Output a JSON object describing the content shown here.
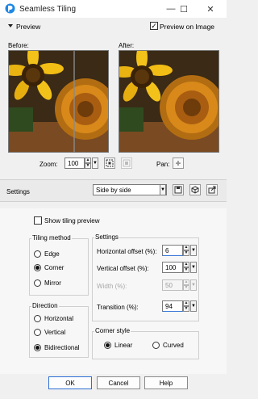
{
  "window": {
    "title": "Seamless Tiling",
    "minimize_icon": "—",
    "maximize_icon": "☐",
    "close_icon": "✕"
  },
  "preview": {
    "header": "Preview",
    "preview_on_image_label": "Preview on Image",
    "preview_on_image_checked": true,
    "before_label": "Before:",
    "after_label": "After:",
    "zoom_label": "Zoom:",
    "zoom_value": "100",
    "pan_label": "Pan:"
  },
  "settings": {
    "label": "Settings",
    "preset_value": "Side by side"
  },
  "show_tiling_preview": {
    "label": "Show tiling preview",
    "checked": false
  },
  "tiling_method": {
    "title": "Tiling method",
    "options": [
      "Edge",
      "Corner",
      "Mirror"
    ],
    "selected": "Corner"
  },
  "direction": {
    "title": "Direction",
    "options": [
      "Horizontal",
      "Vertical",
      "Bidirectional"
    ],
    "selected": "Bidirectional"
  },
  "offsets": {
    "title": "Settings",
    "horizontal_label": "Horizontal offset (%):",
    "horizontal_value": "6",
    "vertical_label": "Vertical offset (%):",
    "vertical_value": "100",
    "width_label": "Width (%):",
    "width_value": "50",
    "transition_label": "Transition (%):",
    "transition_value": "94"
  },
  "corner_style": {
    "title": "Corner style",
    "options": [
      "Linear",
      "Curved"
    ],
    "selected": "Linear"
  },
  "buttons": {
    "ok": "OK",
    "cancel": "Cancel",
    "help": "Help"
  }
}
